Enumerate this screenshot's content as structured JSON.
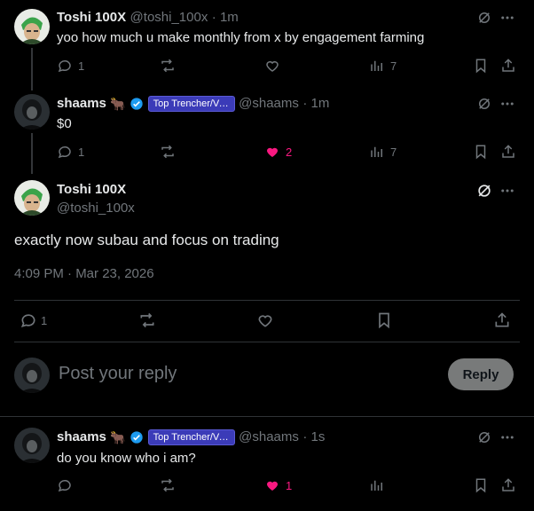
{
  "colors": {
    "bg": "#000000",
    "text": "#e7e9ea",
    "muted": "#71767b",
    "like": "#f91880",
    "badge": "#3b3bb8",
    "verified": "#1d9bf0"
  },
  "post1": {
    "name": "Toshi 100X",
    "handle": "@toshi_100x",
    "time": "· 1m",
    "text": "yoo how much u make monthly from x by engagement farming",
    "replies": "1",
    "likes": "",
    "views": "7"
  },
  "post2": {
    "name": "shaams",
    "badge": "Top Trencher/Ve...",
    "handle": "@shaams",
    "time": "· 1m",
    "text": "$0",
    "replies": "1",
    "likes": "2",
    "views": "7"
  },
  "main_post": {
    "name": "Toshi 100X",
    "handle": "@toshi_100x",
    "text": "exactly now subau and focus on trading",
    "timestamp": "4:09 PM · Mar 23, 2026",
    "replies": "1"
  },
  "composer": {
    "placeholder": "Post your reply",
    "button": "Reply"
  },
  "post3": {
    "name": "shaams",
    "badge": "Top Trencher/Ve...",
    "handle": "@shaams",
    "time": "· 1s",
    "text": "do you know who i am?",
    "likes": "1"
  },
  "icons": [
    "grok-icon",
    "more-icon",
    "reply-icon",
    "repost-icon",
    "like-icon",
    "views-icon",
    "bookmark-icon",
    "share-icon"
  ]
}
